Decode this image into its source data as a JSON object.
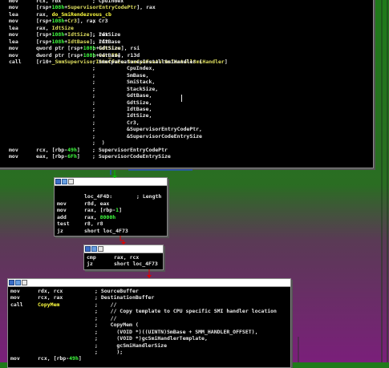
{
  "top_block": {
    "lines": [
      {
        "mn": "mov",
        "segs": [
          {
            "t": "rcx, rbx",
            "c": "reg"
          }
        ],
        "pad": 76,
        "cm": "; CpuIndex"
      },
      {
        "mn": "mov",
        "segs": [
          {
            "t": "[rsp+",
            "c": "reg"
          },
          {
            "t": "108h",
            "c": "num"
          },
          {
            "t": "+",
            "c": "reg"
          },
          {
            "t": "SupervisorEntryCodePtr",
            "c": "sym"
          },
          {
            "t": "], rax",
            "c": "reg"
          }
        ],
        "pad": 0,
        "cm": ""
      },
      {
        "mn": "lea",
        "segs": [
          {
            "t": "rax, ",
            "c": "reg"
          },
          {
            "t": "do_SmiRendezvous_cb",
            "c": "fn"
          }
        ],
        "pad": 0,
        "cm": ""
      },
      {
        "mn": "mov",
        "segs": [
          {
            "t": "[rsp+",
            "c": "reg"
          },
          {
            "t": "108h",
            "c": "num"
          },
          {
            "t": "+",
            "c": "reg"
          },
          {
            "t": "Cr3",
            "c": "sym"
          },
          {
            "t": "], rax",
            "c": "reg"
          }
        ],
        "pad": 76,
        "cm": "; Cr3"
      },
      {
        "mn": "lea",
        "segs": [
          {
            "t": "rax, ",
            "c": "reg"
          },
          {
            "t": "IdtSize",
            "c": "sym"
          }
        ],
        "pad": 0,
        "cm": ""
      },
      {
        "mn": "mov",
        "segs": [
          {
            "t": "[rsp+",
            "c": "reg"
          },
          {
            "t": "108h",
            "c": "num"
          },
          {
            "t": "+",
            "c": "reg"
          },
          {
            "t": "IdtSize",
            "c": "sym"
          },
          {
            "t": "], rax",
            "c": "reg"
          }
        ],
        "pad": 0,
        "cm": "; IdtSize"
      },
      {
        "mn": "lea",
        "segs": [
          {
            "t": "[rsp+",
            "c": "reg"
          },
          {
            "t": "108h",
            "c": "num"
          },
          {
            "t": "+",
            "c": "reg"
          },
          {
            "t": "IdtBase",
            "c": "sym"
          },
          {
            "t": "], r12",
            "c": "reg"
          }
        ],
        "pad": 0,
        "cm": "; IdtBase"
      },
      {
        "mn": "mov",
        "segs": [
          {
            "t": "qword ptr [rsp+",
            "c": "reg"
          },
          {
            "t": "108h",
            "c": "num"
          },
          {
            "t": "+",
            "c": "reg"
          },
          {
            "t": "GdtSize",
            "c": "sym"
          },
          {
            "t": "], rsi",
            "c": "reg"
          }
        ],
        "pad": 0,
        "cm": "; GdtSize"
      },
      {
        "mn": "mov",
        "segs": [
          {
            "t": "dword ptr [rsp+",
            "c": "reg"
          },
          {
            "t": "108h",
            "c": "num"
          },
          {
            "t": "+",
            "c": "reg"
          },
          {
            "t": "var_E8",
            "c": "sym"
          },
          {
            "t": "], r13d",
            "c": "reg"
          }
        ],
        "pad": 0,
        "cm": "; GdtBase"
      },
      {
        "mn": "call",
        "segs": [
          {
            "t": "[r10+",
            "c": "reg"
          },
          {
            "t": "_SmmSupervisorInterface.SmmCpuFeaturesInstallSmiHandler",
            "c": "sym"
          },
          {
            "t": "]",
            "c": "reg"
          }
        ],
        "pad": 0,
        "cm": "; SmmCpuFeaturesInstallSmiHandler ("
      },
      {
        "mn": "",
        "segs": [],
        "pad": 324,
        "cm": ";          CpuIndex,"
      },
      {
        "mn": "",
        "segs": [],
        "pad": 324,
        "cm": ";          SmBase,"
      },
      {
        "mn": "",
        "segs": [],
        "pad": 324,
        "cm": ";          SmiStack,"
      },
      {
        "mn": "",
        "segs": [],
        "pad": 324,
        "cm": ";          StackSize,"
      },
      {
        "mn": "",
        "segs": [],
        "pad": 324,
        "cm": ";          GdtBase,"
      },
      {
        "mn": "",
        "segs": [],
        "pad": 324,
        "cm": ";          GdtSize,"
      },
      {
        "mn": "",
        "segs": [],
        "pad": 324,
        "cm": ";          IdtBase,"
      },
      {
        "mn": "",
        "segs": [],
        "pad": 324,
        "cm": ";          IdtSize,"
      },
      {
        "mn": "",
        "segs": [],
        "pad": 324,
        "cm": ";          Cr3,"
      },
      {
        "mn": "",
        "segs": [],
        "pad": 324,
        "cm": ";          &SupervisorEntryCodePtr,"
      },
      {
        "mn": "",
        "segs": [],
        "pad": 324,
        "cm": ";          &SupervisorCodeEntrySize"
      },
      {
        "mn": "",
        "segs": [],
        "pad": 324,
        "cm": ";  )"
      },
      {
        "mn": "mov",
        "segs": [
          {
            "t": "rcx, [rbp-",
            "c": "reg"
          },
          {
            "t": "49h",
            "c": "num"
          },
          {
            "t": "]",
            "c": "reg"
          }
        ],
        "pad": 0,
        "cm": "; SupervisorEntryCodePtr"
      },
      {
        "mn": "mov",
        "segs": [
          {
            "t": "eax, [rbp-",
            "c": "reg"
          },
          {
            "t": "6Fh",
            "c": "num"
          },
          {
            "t": "]",
            "c": "reg"
          }
        ],
        "pad": 0,
        "cm": "; SupervisorCodeEntrySize"
      }
    ]
  },
  "block2": {
    "lines": [
      {
        "mn": "",
        "segs": [],
        "pad": 0,
        "cm": ""
      },
      {
        "mn": "",
        "segs": [
          {
            "t": "loc_4F4D:",
            "c": "reg"
          }
        ],
        "pad": 0,
        "cm": "; Length"
      },
      {
        "mn": "mov",
        "segs": [
          {
            "t": "r8d, eax",
            "c": "reg"
          }
        ],
        "pad": 0,
        "cm": ""
      },
      {
        "mn": "mov",
        "segs": [
          {
            "t": "rax, [rbp-",
            "c": "reg"
          },
          {
            "t": "1",
            "c": "num"
          },
          {
            "t": "]",
            "c": "reg"
          }
        ],
        "pad": 0,
        "cm": ""
      },
      {
        "mn": "add",
        "segs": [
          {
            "t": "rax, ",
            "c": "reg"
          },
          {
            "t": "8000h",
            "c": "num"
          }
        ],
        "pad": 0,
        "cm": ""
      },
      {
        "mn": "test",
        "segs": [
          {
            "t": "r8, r8",
            "c": "reg"
          }
        ],
        "pad": 0,
        "cm": ""
      },
      {
        "mn": "jz",
        "segs": [
          {
            "t": "short loc_4F73",
            "c": "reg"
          }
        ],
        "pad": 0,
        "cm": ""
      }
    ]
  },
  "block3": {
    "lines": [
      {
        "mn": "cmp",
        "segs": [
          {
            "t": "rax, rcx",
            "c": "reg"
          }
        ],
        "pad": 0,
        "cm": ""
      },
      {
        "mn": "jz",
        "segs": [
          {
            "t": "short loc_4F73",
            "c": "reg"
          }
        ],
        "pad": 0,
        "cm": ""
      }
    ]
  },
  "block4": {
    "lines": [
      {
        "mn": "mov",
        "segs": [
          {
            "t": "rdx, rcx",
            "c": "reg"
          }
        ],
        "pad": 0,
        "cm": "; SourceBuffer"
      },
      {
        "mn": "mov",
        "segs": [
          {
            "t": "rcx, rax",
            "c": "reg"
          }
        ],
        "pad": 0,
        "cm": "; DestinationBuffer"
      },
      {
        "mn": "call",
        "segs": [
          {
            "t": "CopyMem",
            "c": "fn"
          }
        ],
        "pad": 0,
        "cm": ";    //"
      },
      {
        "mn": "",
        "segs": [],
        "pad": 0,
        "cm": ";    // Copy template to CPU specific SMI handler location"
      },
      {
        "mn": "",
        "segs": [],
        "pad": 0,
        "cm": ";    //"
      },
      {
        "mn": "",
        "segs": [],
        "pad": 0,
        "cm": ";    CopyMem ("
      },
      {
        "mn": "",
        "segs": [],
        "pad": 0,
        "cm": ";      (VOID *)((UINTN)SmBase + SMM_HANDLER_OFFSET),"
      },
      {
        "mn": "",
        "segs": [],
        "pad": 0,
        "cm": ";      (VOID *)gcSmiHandlerTemplate,"
      },
      {
        "mn": "",
        "segs": [],
        "pad": 0,
        "cm": ";      gcSmiHandlerSize"
      },
      {
        "mn": "",
        "segs": [],
        "pad": 0,
        "cm": ";      );"
      },
      {
        "mn": "mov",
        "segs": [
          {
            "t": "rcx, [rbp-",
            "c": "reg"
          },
          {
            "t": "49h",
            "c": "num"
          },
          {
            "t": "]",
            "c": "reg"
          }
        ],
        "pad": 0,
        "cm": ""
      }
    ]
  },
  "colors": {
    "background_top": "#1f7a1a",
    "background_bottom": "#7a1f7a",
    "node_bg": "#000000",
    "text": "#e8e8e8",
    "symbol": "#e0e060",
    "function": "#ffff40",
    "number": "#40ff40",
    "edge_true": "#00c000",
    "edge_false": "#e00000",
    "edge_normal": "#2050ff"
  }
}
